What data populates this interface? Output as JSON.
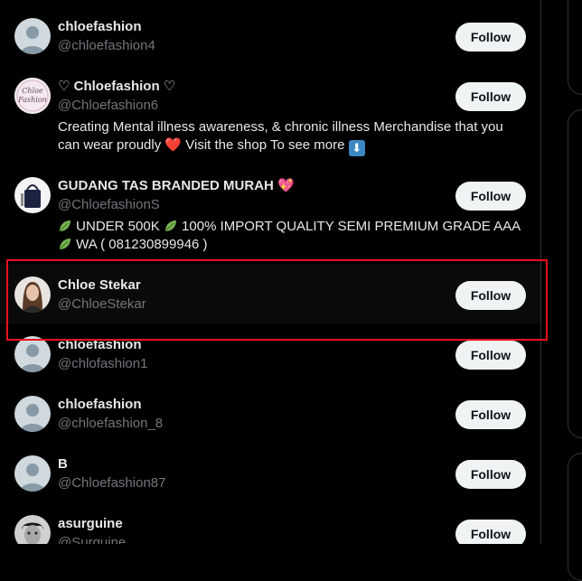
{
  "users": [
    {
      "name": "chloefashion",
      "handle": "@chloefashion4",
      "follow": "Follow",
      "avatar": "default-avatar-icon"
    },
    {
      "name": "♡ Chloefashion ♡",
      "handle": "@Chloefashion6",
      "follow": "Follow",
      "avatar": "chloe-fashion-logo",
      "logo_text": "Chloe Fashion",
      "bio_a": "Creating Mental illness awareness, & chronic illness Merchandise that you can wear proudly ",
      "bio_heart": "❤️",
      "bio_b": " Visit the shop To see more ",
      "bio_arrow": "⬇"
    },
    {
      "name": "GUDANG TAS BRANDED MURAH 💖",
      "handle": "@ChloefashionS",
      "follow": "Follow",
      "avatar": "handbag-photo",
      "bio_line1_a": " UNDER 500K ",
      "bio_line1_b": " 100% IMPORT QUALITY SEMI PREMIUM GRADE AAA",
      "bio_line2": " WA ( 081230899946 )"
    },
    {
      "name": "Chloe Stekar",
      "handle": "@ChloeStekar",
      "follow": "Follow",
      "avatar": "portrait-photo"
    },
    {
      "name": "chloefashion",
      "handle": "@chlofashion1",
      "follow": "Follow",
      "avatar": "default-avatar-icon"
    },
    {
      "name": "chloefashion",
      "handle": "@chloefashion_8",
      "follow": "Follow",
      "avatar": "default-avatar-icon"
    },
    {
      "name": "B",
      "handle": "@Chloefashion87",
      "follow": "Follow",
      "avatar": "default-avatar-icon"
    },
    {
      "name": "asurguine",
      "handle": "@Surguine",
      "follow": "Follow",
      "avatar": "bw-portrait-photo"
    }
  ],
  "colors": {
    "accent_highlight": "#e8121b",
    "follow_bg": "#eff3f4",
    "muted": "#71767b"
  }
}
